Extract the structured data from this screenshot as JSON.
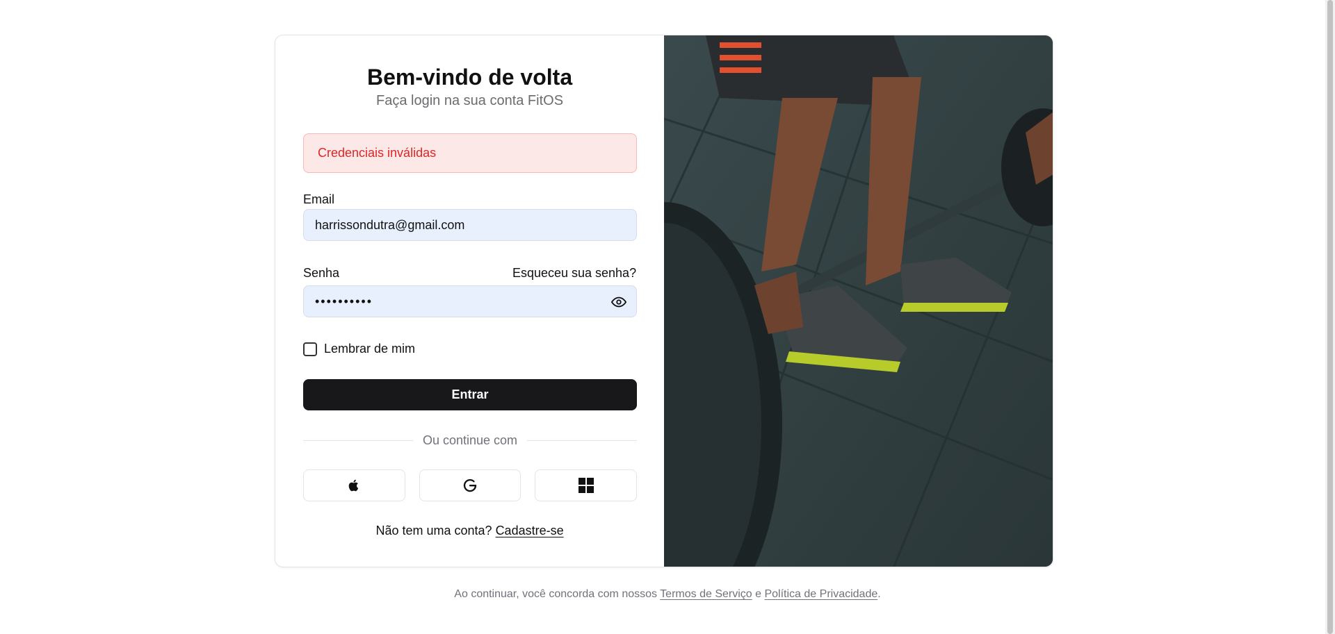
{
  "login": {
    "title": "Bem-vindo de volta",
    "subtitle": "Faça login na sua conta FitOS",
    "error": "Credenciais inválidas",
    "email_label": "Email",
    "email_value": "harrissondutra@gmail.com",
    "password_label": "Senha",
    "forgot_password": "Esqueceu sua senha?",
    "password_value": "••••••••••",
    "remember_label": "Lembrar de mim",
    "submit_label": "Entrar",
    "divider_text": "Ou continue com",
    "signup_prompt": "Não tem uma conta?",
    "signup_link": "Cadastre-se"
  },
  "social": [
    "apple-icon",
    "google-icon",
    "windows-icon"
  ],
  "footer": {
    "prefix": "Ao continuar, você concorda com nossos",
    "terms_link": "Termos de Serviço",
    "conjunction": "e",
    "privacy_link": "Política de Privacidade",
    "suffix": "."
  },
  "colors": {
    "primary": "#18181b",
    "error_text": "#dc2626",
    "error_bg": "#fde8e8",
    "input_bg": "#e8f0fe"
  }
}
